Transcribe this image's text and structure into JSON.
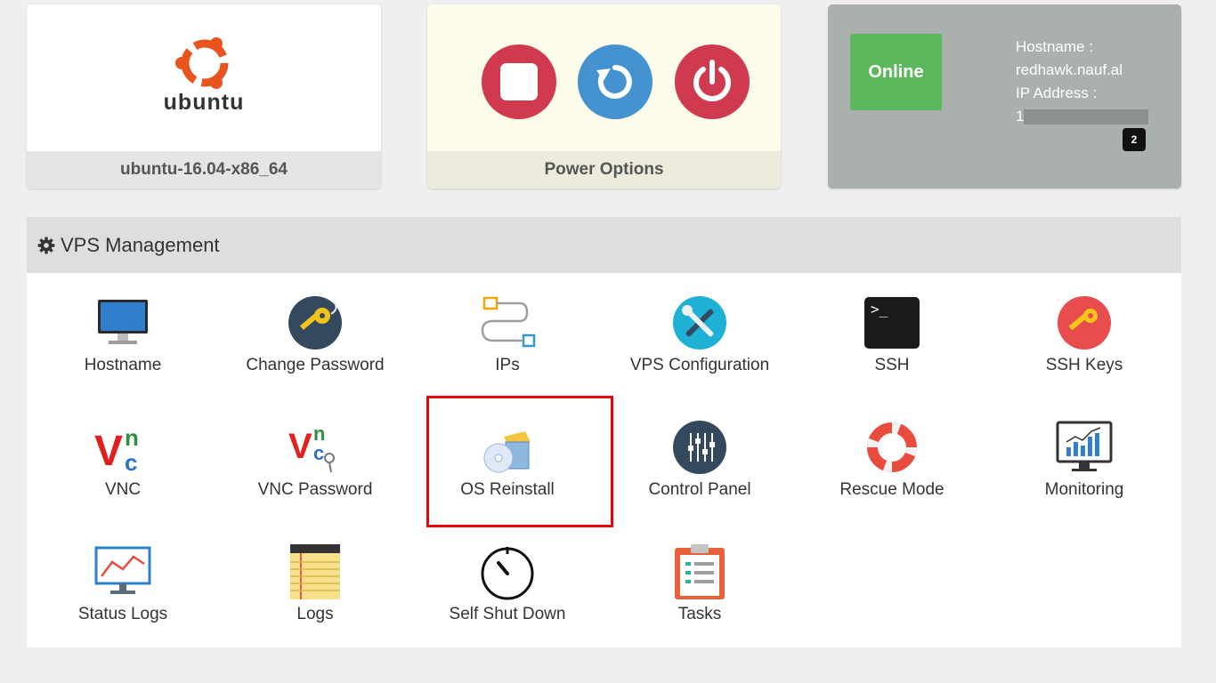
{
  "os_card": {
    "logo_text": "ubuntu",
    "label": "ubuntu-16.04-x86_64"
  },
  "power_card": {
    "label": "Power Options",
    "buttons": [
      "stop-icon",
      "restart-icon",
      "power-off-icon"
    ]
  },
  "status_card": {
    "status": "Online",
    "hostname_label": "Hostname :",
    "hostname_value": "redhawk.nauf.al",
    "ip_label": "IP Address :",
    "ip_value_prefix": "1",
    "badge_count": "2",
    "colors": {
      "online": "#5cb85c",
      "card": "#a9b0ad"
    }
  },
  "vps_management": {
    "title": "VPS Management",
    "tiles": [
      {
        "label": "Hostname",
        "icon": "monitor-icon"
      },
      {
        "label": "Change Password",
        "icon": "key-icon"
      },
      {
        "label": "IPs",
        "icon": "network-icon"
      },
      {
        "label": "VPS Configuration",
        "icon": "tools-icon"
      },
      {
        "label": "SSH",
        "icon": "terminal-icon"
      },
      {
        "label": "SSH Keys",
        "icon": "ssh-key-icon"
      },
      {
        "label": "VNC",
        "icon": "vnc-icon"
      },
      {
        "label": "VNC Password",
        "icon": "vnc-password-icon"
      },
      {
        "label": "OS Reinstall",
        "icon": "os-reinstall-icon"
      },
      {
        "label": "Control Panel",
        "icon": "sliders-icon"
      },
      {
        "label": "Rescue Mode",
        "icon": "lifebuoy-icon"
      },
      {
        "label": "Monitoring",
        "icon": "monitoring-icon"
      },
      {
        "label": "Status Logs",
        "icon": "status-chart-icon"
      },
      {
        "label": "Logs",
        "icon": "notepad-icon"
      },
      {
        "label": "Self Shut Down",
        "icon": "timer-icon"
      },
      {
        "label": "Tasks",
        "icon": "clipboard-icon"
      }
    ]
  },
  "colors": {
    "danger": "#d03a4e",
    "primary": "#4492d0",
    "highlight": "#e8000c"
  }
}
